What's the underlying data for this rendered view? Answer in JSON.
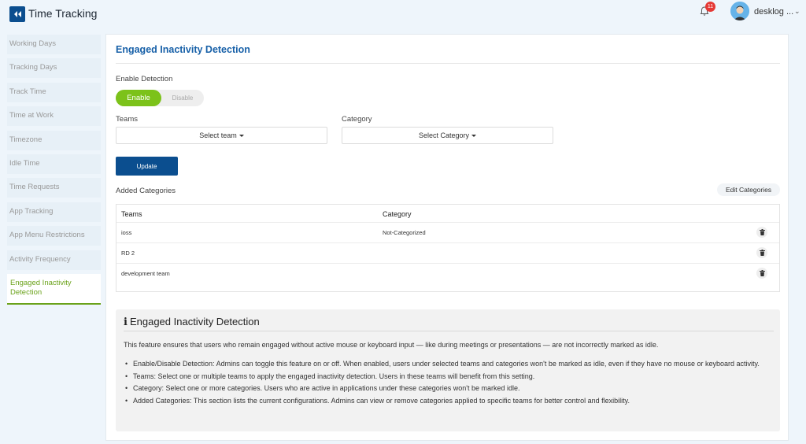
{
  "header": {
    "app_title": "Time Tracking",
    "notification_count": "11",
    "user_name": "desklog ...",
    "brand_color": "#0b4e8f",
    "badge_color": "#e53935"
  },
  "sidebar": {
    "items": [
      {
        "label": "Working Days"
      },
      {
        "label": "Tracking Days"
      },
      {
        "label": "Track Time"
      },
      {
        "label": "Time at Work"
      },
      {
        "label": "Timezone"
      },
      {
        "label": "Idle Time"
      },
      {
        "label": "Time Requests"
      },
      {
        "label": "App Tracking"
      },
      {
        "label": "App Menu Restrictions"
      },
      {
        "label": "Activity Frequency"
      },
      {
        "label": "Engaged Inactivity Detection",
        "active": true
      }
    ],
    "active_color": "#6aa21a"
  },
  "main": {
    "title": "Engaged Inactivity Detection",
    "enable_label": "Enable Detection",
    "toggle": {
      "on_label": "Enable",
      "off_label": "Disable",
      "state": "Enable",
      "on_color": "#7cc21a"
    },
    "teams_label": "Teams",
    "teams_select": "Select team",
    "category_label": "Category",
    "category_select": "Select Category",
    "update_label": "Update",
    "added_categories_label": "Added Categories",
    "edit_categories_label": "Edit Categories",
    "table": {
      "headers": [
        "Teams",
        "Category"
      ],
      "rows": [
        {
          "team": "ioss",
          "category": "Not-Categorized"
        },
        {
          "team": "RD 2",
          "category": ""
        },
        {
          "team": "development team",
          "category": ""
        }
      ]
    }
  },
  "info": {
    "title": "Engaged Inactivity Detection",
    "intro": "This feature ensures that users who remain engaged without active mouse or keyboard input — like during meetings or presentations — are not incorrectly marked as idle.",
    "bullets": [
      "Enable/Disable Detection: Admins can toggle this feature on or off. When enabled, users under selected teams and categories won't be marked as idle, even if they have no mouse or keyboard activity.",
      "Teams: Select one or multiple teams to apply the engaged inactivity detection. Users in these teams will benefit from this setting.",
      "Category: Select one or more categories. Users who are active in applications under these categories won't be marked idle.",
      "Added Categories: This section lists the current configurations. Admins can view or remove categories applied to specific teams for better control and flexibility."
    ]
  }
}
